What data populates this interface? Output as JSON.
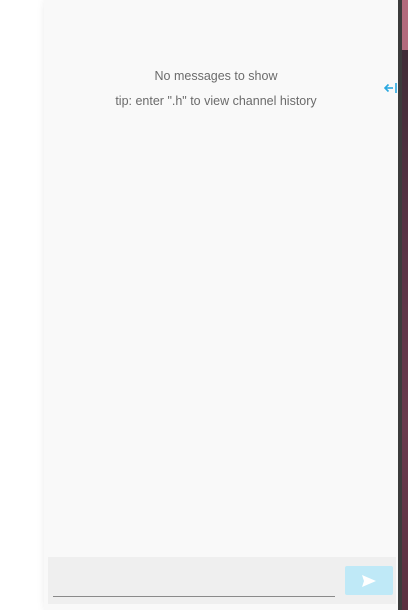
{
  "chat": {
    "empty_title": "No messages to show",
    "empty_tip": "tip: enter \".h\" to view channel history"
  },
  "composer": {
    "input_value": "",
    "input_placeholder": "",
    "send_icon": "send-arrow-icon"
  },
  "sidebar_toggle": {
    "icon": "arrow-left-bar-icon"
  },
  "colors": {
    "panel_bg": "#f9f9f9",
    "composer_bg": "#efefef",
    "send_button_bg": "#bfe9f7",
    "accent": "#29a8e0",
    "muted_text": "#6b6b6b"
  }
}
